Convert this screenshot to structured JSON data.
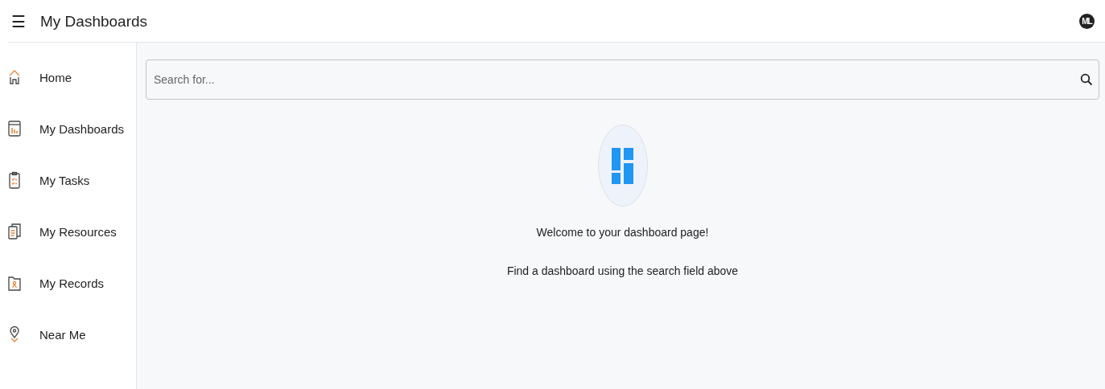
{
  "header": {
    "menu_icon": "☰",
    "title": "My Dashboards",
    "avatar": "ML"
  },
  "sidebar": {
    "items": [
      {
        "label": "Home",
        "kind": "home"
      },
      {
        "label": "My Dashboards",
        "kind": "dashboard"
      },
      {
        "label": "My Tasks",
        "kind": "tasks"
      },
      {
        "label": "My Resources",
        "kind": "resources"
      },
      {
        "label": "My Records",
        "kind": "records"
      },
      {
        "label": "Near Me",
        "kind": "location"
      }
    ]
  },
  "search": {
    "placeholder": "Search for..."
  },
  "empty_state": {
    "heading": "Welcome to your dashboard page!",
    "hint": "Find a dashboard using the search field above"
  }
}
